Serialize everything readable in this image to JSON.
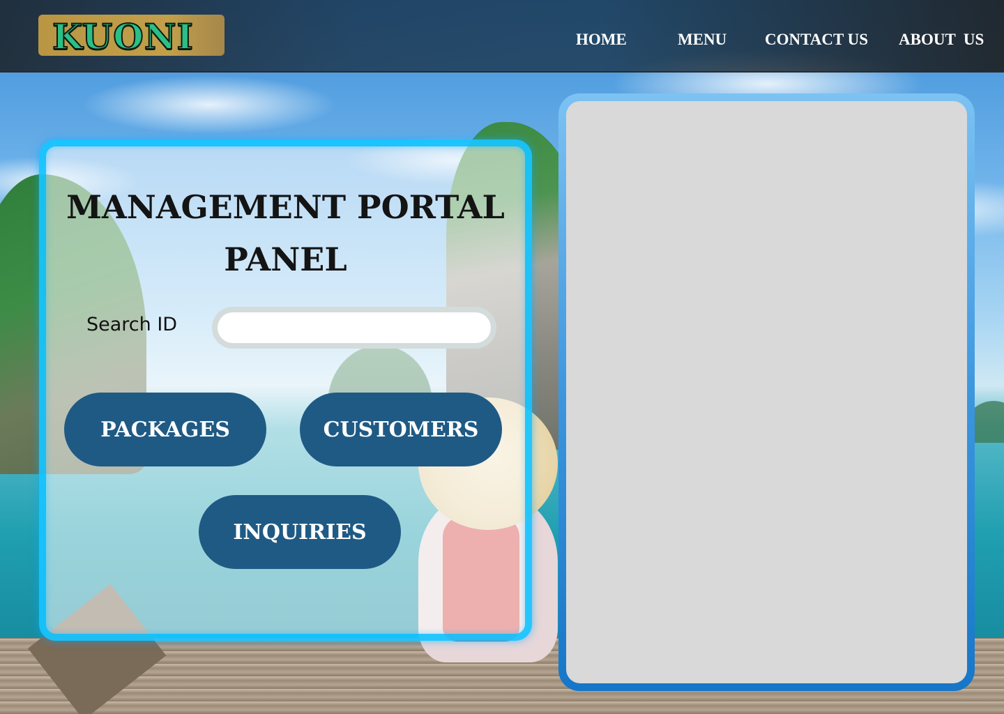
{
  "brand": {
    "logo_text": "KUONI"
  },
  "nav": {
    "items": [
      {
        "label": "HOME"
      },
      {
        "label": "MENU"
      },
      {
        "label": "CONTACT US"
      },
      {
        "label": "ABOUT  US"
      }
    ]
  },
  "panel": {
    "title_line1": "MANAGEMENT PORTAL",
    "title_line2": "PANEL",
    "search_label": "Search ID",
    "search_value": "",
    "buttons": {
      "packages": "PACKAGES",
      "customers": "CUSTOMERS",
      "inquiries": "INQUIRIES"
    }
  },
  "colors": {
    "panel_border": "#00bfff",
    "button_fill": "#1f5a85",
    "logo_bg": "#c29f4a",
    "logo_text": "#2bbf86",
    "right_panel_fill": "#d9d9d9"
  }
}
